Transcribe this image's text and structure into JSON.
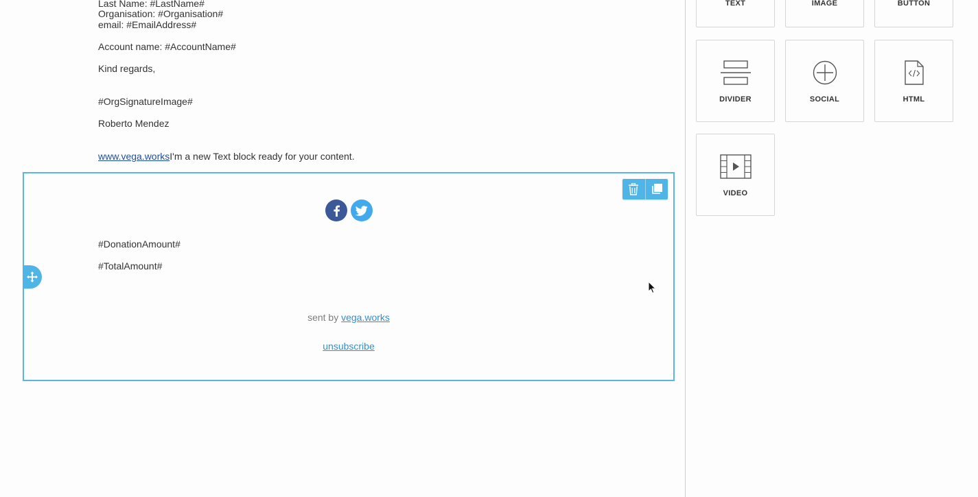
{
  "email": {
    "lines": [
      "Last Name: #LastName#",
      "Organisation: #Organisation#",
      "email: #EmailAddress#",
      "Account name: #AccountName#",
      "Kind regards,",
      "#OrgSignatureImage#",
      "Roberto Mendez"
    ],
    "site_link": "www.vega.works",
    "text_block_placeholder": "I'm a new Text block ready for your content.",
    "selected_block": {
      "donation_amount": "#DonationAmount#",
      "total_amount": "#TotalAmount#",
      "sent_by_prefix": "sent by ",
      "sent_by_link": "vega.works",
      "unsubscribe": "unsubscribe"
    }
  },
  "sidebar": {
    "tiles": [
      {
        "label": "TEXT"
      },
      {
        "label": "IMAGE"
      },
      {
        "label": "BUTTON"
      },
      {
        "label": "DIVIDER"
      },
      {
        "label": "SOCIAL"
      },
      {
        "label": "HTML"
      },
      {
        "label": "VIDEO"
      }
    ]
  },
  "colors": {
    "accent": "#4fb4e6",
    "facebook": "#3b5998",
    "twitter": "#42aaec"
  }
}
